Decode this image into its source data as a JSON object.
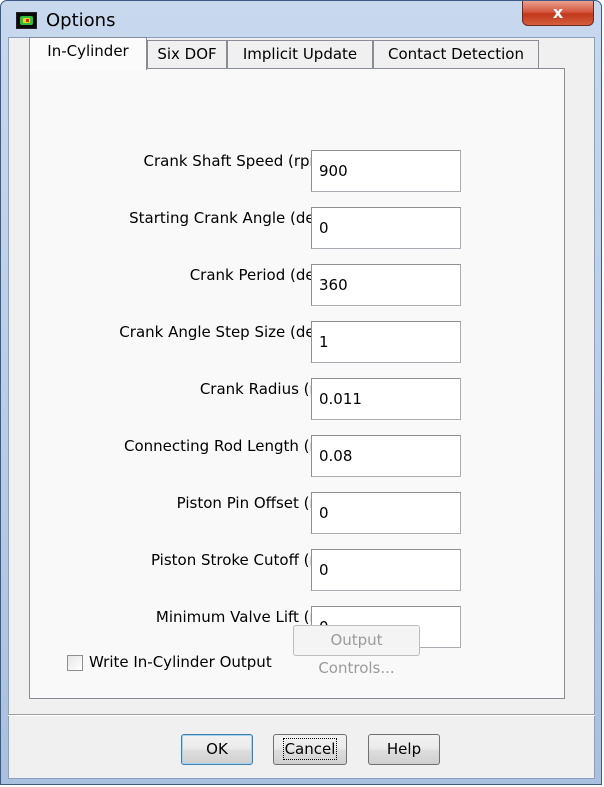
{
  "window": {
    "title": "Options",
    "close_glyph": "x",
    "accent_color": "#c3381d"
  },
  "tabs": [
    {
      "label": "In-Cylinder",
      "active": true
    },
    {
      "label": "Six DOF",
      "active": false
    },
    {
      "label": "Implicit Update",
      "active": false
    },
    {
      "label": "Contact Detection",
      "active": false
    }
  ],
  "fields": [
    {
      "label": "Crank Shaft Speed (rpm)",
      "value": "900"
    },
    {
      "label": "Starting Crank Angle (deg)",
      "value": "0"
    },
    {
      "label": "Crank Period (deg)",
      "value": "360"
    },
    {
      "label": "Crank Angle Step Size (deg)",
      "value": "1"
    },
    {
      "label": "Crank Radius (m)",
      "value": "0.011"
    },
    {
      "label": "Connecting Rod Length (m)",
      "value": "0.08"
    },
    {
      "label": "Piston Pin Offset (m)",
      "value": "0"
    },
    {
      "label": "Piston Stroke Cutoff (m)",
      "value": "0"
    },
    {
      "label": "Minimum Valve Lift (m)",
      "value": "0"
    }
  ],
  "output": {
    "checkbox_label": "Write In-Cylinder Output",
    "checked": false,
    "controls_label": "Output Controls..."
  },
  "buttons": {
    "ok": "OK",
    "cancel": "Cancel",
    "help": "Help"
  }
}
